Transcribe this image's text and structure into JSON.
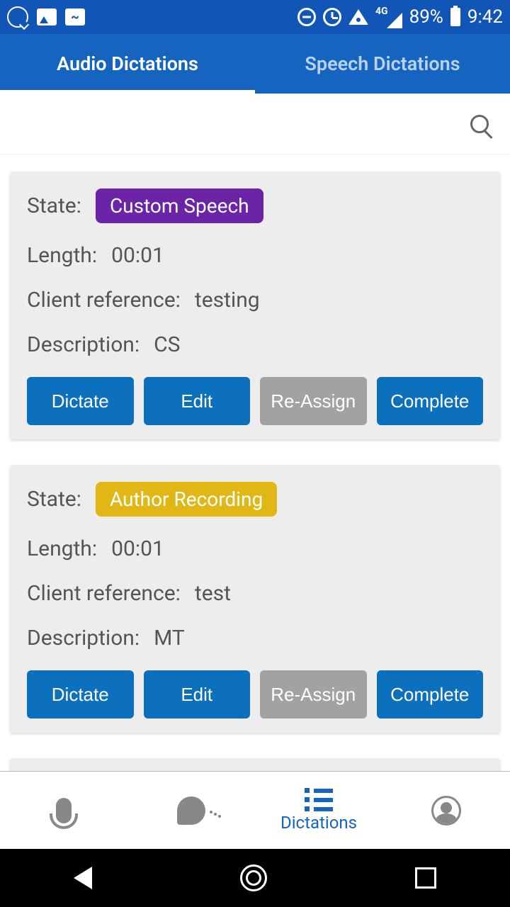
{
  "status": {
    "network": "4G",
    "battery": "89%",
    "time": "9:42"
  },
  "tabs": {
    "audio": "Audio Dictations",
    "speech": "Speech Dictations"
  },
  "labels": {
    "state": "State:",
    "length": "Length:",
    "clientref": "Client reference:",
    "description": "Description:"
  },
  "buttons": {
    "dictate": "Dictate",
    "edit": "Edit",
    "reassign": "Re-Assign",
    "complete": "Complete"
  },
  "cards": [
    {
      "state": "Custom Speech",
      "state_color": "purple",
      "length": "00:01",
      "clientref": "testing",
      "description": "CS"
    },
    {
      "state": "Author Recording",
      "state_color": "yellow",
      "length": "00:01",
      "clientref": "test",
      "description": "MT"
    }
  ],
  "bottomnav": {
    "dictations": "Dictations"
  }
}
